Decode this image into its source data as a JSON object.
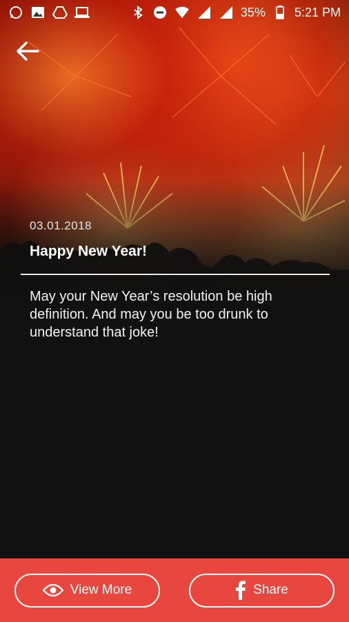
{
  "status_bar": {
    "battery": "35%",
    "time": "5:21 PM",
    "icons_left": [
      "whatsapp-icon",
      "gallery-icon",
      "drive-icon",
      "laptop-icon"
    ],
    "icons_right": [
      "bluetooth-icon",
      "dnd-icon",
      "wifi-icon",
      "signal-icon",
      "battery-icon"
    ]
  },
  "header": {
    "back_icon": "arrow-left-icon"
  },
  "post": {
    "date": "03.01.2018",
    "title": "Happy New Year!",
    "body": "May your New Year’s resolution be high definition. And may you be too drunk to understand that joke!"
  },
  "actions": {
    "view_more_label": "View More",
    "view_more_icon": "eye-icon",
    "share_label": "Share",
    "share_icon": "facebook-icon"
  },
  "colors": {
    "accent": "#e8473f",
    "background": "#111111"
  }
}
